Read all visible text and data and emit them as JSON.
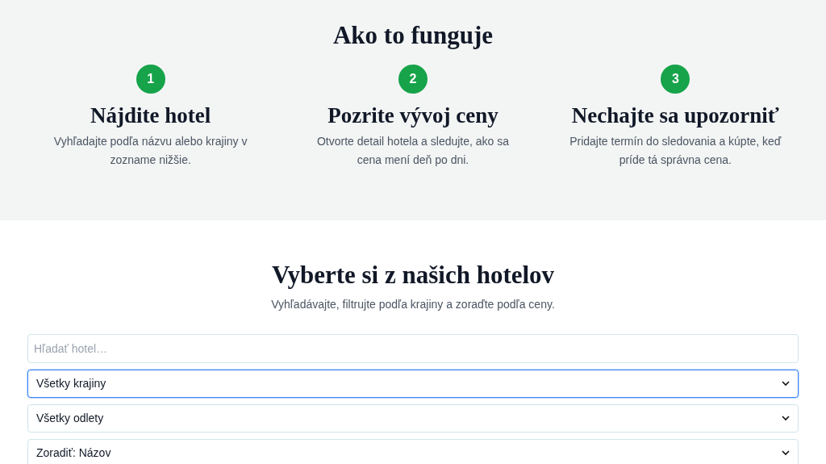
{
  "how_it_works": {
    "title": "Ako to funguje",
    "steps": [
      {
        "number": "1",
        "title": "Nájdite hotel",
        "text": "Vyhľadajte podľa názvu alebo krajiny v zozname nižšie."
      },
      {
        "number": "2",
        "title": "Pozrite vývoj ceny",
        "text": "Otvorte detail hotela a sledujte, ako sa cena mení deň po dni."
      },
      {
        "number": "3",
        "title": "Nechajte sa upozorniť",
        "text": "Pridajte termín do sledovania a kúpte, keď príde tá správna cena."
      }
    ]
  },
  "hotels": {
    "title": "Vyberte si z našich hotelov",
    "subtitle": "Vyhľadávajte, filtrujte podľa krajiny a zoraďte podľa ceny.",
    "search": {
      "placeholder": "Hľadať hotel…"
    },
    "filters": [
      {
        "value": "Všetky krajiny",
        "focused": true
      },
      {
        "value": "Všetky odlety",
        "focused": false
      },
      {
        "value": "Zoradiť: Názov",
        "focused": false
      }
    ]
  }
}
